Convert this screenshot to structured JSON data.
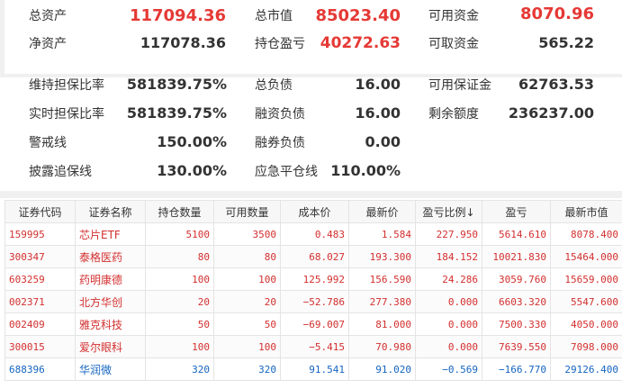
{
  "summary": {
    "total_assets_label": "总资产",
    "total_assets_value": "117094.36",
    "market_value_label": "总市值",
    "market_value_value": "85023.40",
    "available_funds_label": "可用资金",
    "available_funds_value": "8070.96",
    "net_assets_label": "净资产",
    "net_assets_value": "117078.36",
    "position_pnl_label": "持仓盈亏",
    "position_pnl_value": "40272.63",
    "withdrawable_label": "可取资金",
    "withdrawable_value": "565.22"
  },
  "margin": {
    "maintain_ratio_label": "维持担保比率",
    "maintain_ratio_value": "581839.75%",
    "total_liab_label": "总负债",
    "total_liab_value": "16.00",
    "avail_margin_label": "可用保证金",
    "avail_margin_value": "62763.53",
    "realtime_ratio_label": "实时担保比率",
    "realtime_ratio_value": "581839.75%",
    "fin_liab_label": "融资负债",
    "fin_liab_value": "16.00",
    "remaining_quota_label": "剩余额度",
    "remaining_quota_value": "236237.00",
    "warning_line_label": "警戒线",
    "warning_line_value": "150.00%",
    "sec_liab_label": "融券负债",
    "sec_liab_value": "0.00",
    "disclosure_line_label": "披露追保线",
    "disclosure_line_value": "130.00%",
    "emergency_line_label": "应急平仓线",
    "emergency_line_value": "110.00%"
  },
  "table": {
    "headers": [
      "证券代码",
      "证券名称",
      "持仓数量",
      "可用数量",
      "成本价",
      "最新价",
      "盈亏比例",
      "盈亏",
      "最新市值"
    ],
    "sort_indicator": "↓",
    "rows": [
      {
        "code": "159995",
        "name": "芯片ETF",
        "hold": "5100",
        "avail": "3500",
        "cost": "0.483",
        "price": "1.584",
        "pnl_pct": "227.950",
        "pnl": "5614.610",
        "mv": "8078.400",
        "trend": "up"
      },
      {
        "code": "300347",
        "name": "泰格医药",
        "hold": "80",
        "avail": "80",
        "cost": "68.027",
        "price": "193.300",
        "pnl_pct": "184.152",
        "pnl": "10021.830",
        "mv": "15464.000",
        "trend": "up"
      },
      {
        "code": "603259",
        "name": "药明康德",
        "hold": "100",
        "avail": "100",
        "cost": "125.992",
        "price": "156.590",
        "pnl_pct": "24.286",
        "pnl": "3059.760",
        "mv": "15659.000",
        "trend": "up"
      },
      {
        "code": "002371",
        "name": "北方华创",
        "hold": "20",
        "avail": "20",
        "cost": "−52.786",
        "price": "277.380",
        "pnl_pct": "0.000",
        "pnl": "6603.320",
        "mv": "5547.600",
        "trend": "up"
      },
      {
        "code": "002409",
        "name": "雅克科技",
        "hold": "50",
        "avail": "50",
        "cost": "−69.007",
        "price": "81.000",
        "pnl_pct": "0.000",
        "pnl": "7500.330",
        "mv": "4050.000",
        "trend": "up"
      },
      {
        "code": "300015",
        "name": "爱尔眼科",
        "hold": "100",
        "avail": "100",
        "cost": "−5.415",
        "price": "70.980",
        "pnl_pct": "0.000",
        "pnl": "7639.550",
        "mv": "7098.000",
        "trend": "up"
      },
      {
        "code": "688396",
        "name": "华润微",
        "hold": "320",
        "avail": "320",
        "cost": "91.541",
        "price": "91.020",
        "pnl_pct": "−0.569",
        "pnl": "−166.770",
        "mv": "29126.400",
        "trend": "down"
      }
    ]
  }
}
